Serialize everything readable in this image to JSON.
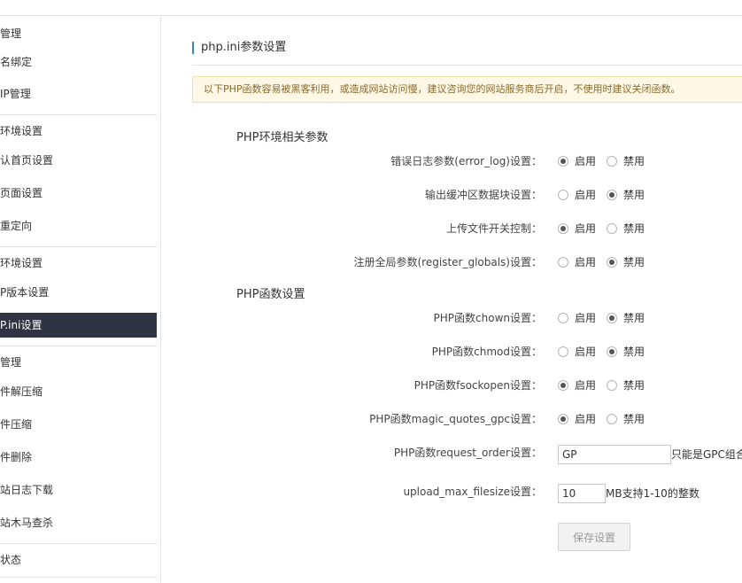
{
  "sidebar": {
    "items": [
      {
        "label": "管理"
      },
      {
        "label": "名绑定"
      },
      {
        "label": "IP管理"
      },
      {
        "label": "环境设置"
      },
      {
        "label": "认首页设置"
      },
      {
        "label": "页面设置"
      },
      {
        "label": "重定向"
      },
      {
        "label": "环境设置"
      },
      {
        "label": "P版本设置"
      },
      {
        "label": "P.ini设置"
      },
      {
        "label": "管理"
      },
      {
        "label": "件解压缩"
      },
      {
        "label": "件压缩"
      },
      {
        "label": "件删除"
      },
      {
        "label": "站日志下载"
      },
      {
        "label": "站木马查杀"
      },
      {
        "label": "状态"
      }
    ]
  },
  "main": {
    "title": "php.ini参数设置",
    "notice": "以下PHP函数容易被黑客利用，或造成网站访问慢，建议咨询您的网站服务商后开启，不使用时建议关闭函数。",
    "section1": "PHP环境相关参数",
    "section2": "PHP函数设置",
    "options": {
      "enable": "启用",
      "disable": "禁用"
    },
    "rows": [
      {
        "label": "错误日志参数(error_log)设置：",
        "value": "enable"
      },
      {
        "label": "输出缓冲区数据块设置：",
        "value": "disable"
      },
      {
        "label": "上传文件开关控制：",
        "value": "enable"
      },
      {
        "label": "注册全局参数(register_globals)设置：",
        "value": "disable"
      },
      {
        "label": "PHP函数chown设置：",
        "value": "disable"
      },
      {
        "label": "PHP函数chmod设置：",
        "value": "disable"
      },
      {
        "label": "PHP函数fsockopen设置：",
        "value": "enable"
      },
      {
        "label": "PHP函数magic_quotes_gpc设置：",
        "value": "enable"
      }
    ],
    "request_order": {
      "label": "PHP函数request_order设置：",
      "value": "GP",
      "hint": "只能是GPC组合"
    },
    "upload_max": {
      "label": "upload_max_filesize设置：",
      "value": "10",
      "hint": "MB支持1-10的整数"
    },
    "save_label": "保存设置"
  }
}
